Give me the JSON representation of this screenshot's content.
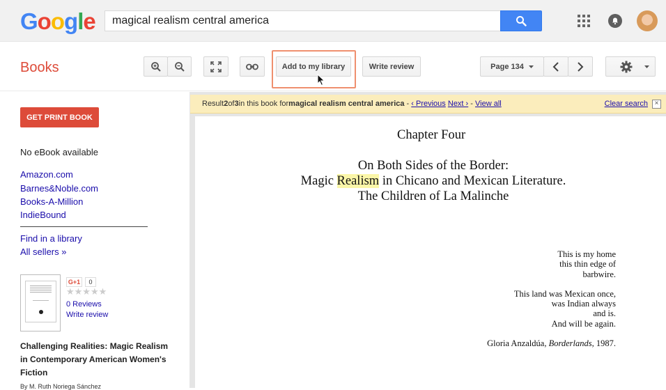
{
  "header": {
    "logo": [
      "G",
      "o",
      "o",
      "g",
      "l",
      "e"
    ],
    "logo_colors": [
      "#4285f4",
      "#ea4335",
      "#fbbc05",
      "#4285f4",
      "#34a853",
      "#ea4335"
    ],
    "search_value": "magical realism central america"
  },
  "toolbar": {
    "title": "Books",
    "add_library": "Add to my library",
    "write_review": "Write review",
    "page_label": "Page 134"
  },
  "sidebar": {
    "print_button": "GET PRINT BOOK",
    "no_ebook": "No eBook available",
    "sellers": [
      "Amazon.com",
      "Barnes&Noble.com",
      "Books-A-Million",
      "IndieBound"
    ],
    "find_library": "Find in a library",
    "all_sellers": "All sellers »",
    "gplus": "G+1",
    "gplus_count": "0",
    "reviews": "0 Reviews",
    "write_review": "Write review",
    "book_title": "Challenging Realities: Magic Realism in Contemporary American Women's Fiction",
    "author": "By M. Ruth Noriega Sánchez"
  },
  "result_bar": {
    "prefix": "Result ",
    "current": "2",
    "of": " of ",
    "total": "3",
    "mid": " in this book for ",
    "query": "magical realism central america",
    "sep1": " - ",
    "previous": "‹ Previous",
    "next": "Next ›",
    "sep2": " - ",
    "view_all": "View all",
    "clear": "Clear search"
  },
  "page": {
    "chapter": "Chapter Four",
    "line1": "On Both Sides of the Border:",
    "line2_a": "Magic ",
    "line2_hl": "Realism",
    "line2_b": " in Chicano and Mexican Literature.",
    "line3": "The Children of La Malinche",
    "poem": [
      "This is my home",
      "this thin edge of",
      "barbwire."
    ],
    "poem2": [
      "This land was Mexican once,",
      "was Indian always",
      "and is.",
      "And will be again."
    ],
    "citation_a": "Gloria Anzaldúa, ",
    "citation_i": "Borderlands",
    "citation_b": ", 1987."
  }
}
